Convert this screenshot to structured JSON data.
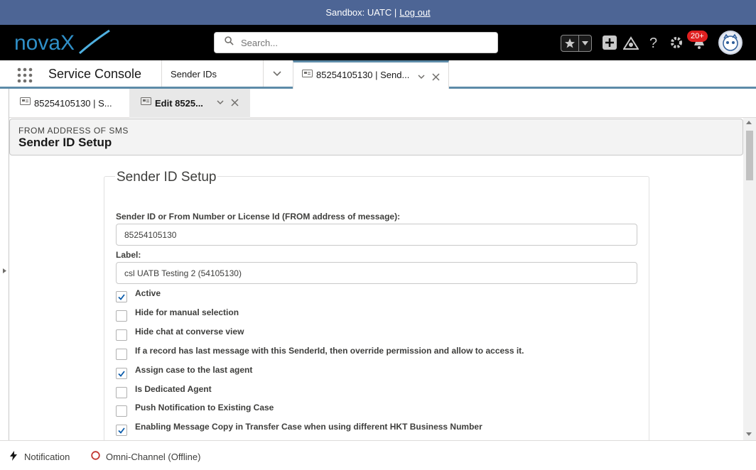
{
  "sandbox": {
    "label": "Sandbox: UATC |",
    "logout": "Log out"
  },
  "header": {
    "logo_text": "novaX",
    "search": {
      "placeholder": "Search...",
      "value": ""
    },
    "notification_count": "20+",
    "icons": [
      "star-icon",
      "chevron-down-icon",
      "plus-icon",
      "trailhead-icon",
      "help-icon",
      "gear-icon",
      "bell-icon",
      "avatar"
    ]
  },
  "nav": {
    "app_name": "Service Console",
    "nav_item": "Sender IDs",
    "workspace_tab": "85254105130 | Send..."
  },
  "subtabs": [
    {
      "label": "85254105130 | S..."
    },
    {
      "label": "Edit 8525..."
    }
  ],
  "page": {
    "eyebrow": "FROM ADDRESS OF SMS",
    "title": "Sender ID Setup"
  },
  "form": {
    "legend": "Sender ID Setup",
    "fields": [
      {
        "label": "Sender ID or From Number or License Id (FROM address of message):",
        "value": "85254105130"
      },
      {
        "label": "Label:",
        "value": "csl UATB Testing 2 (54105130)"
      }
    ],
    "checkboxes": [
      {
        "label": "Active",
        "checked": true
      },
      {
        "label": "Hide for manual selection",
        "checked": false
      },
      {
        "label": "Hide chat at converse view",
        "checked": false
      },
      {
        "label": "If a record has last message with this SenderId, then override permission and allow to access it.",
        "checked": false
      },
      {
        "label": "Assign case to the last agent",
        "checked": true
      },
      {
        "label": "Is Dedicated Agent",
        "checked": false
      },
      {
        "label": "Push Notification to Existing Case",
        "checked": false
      },
      {
        "label": "Enabling Message Copy in Transfer Case when using different HKT Business Number",
        "checked": true
      }
    ]
  },
  "utility": {
    "notification": "Notification",
    "omni": "Omni-Channel (Offline)"
  },
  "colors": {
    "sandbox_bar": "#4d6595",
    "header": "#000000",
    "accent": "#5d8ba8",
    "badge": "#e02020",
    "omni_offline": "#c23934"
  }
}
